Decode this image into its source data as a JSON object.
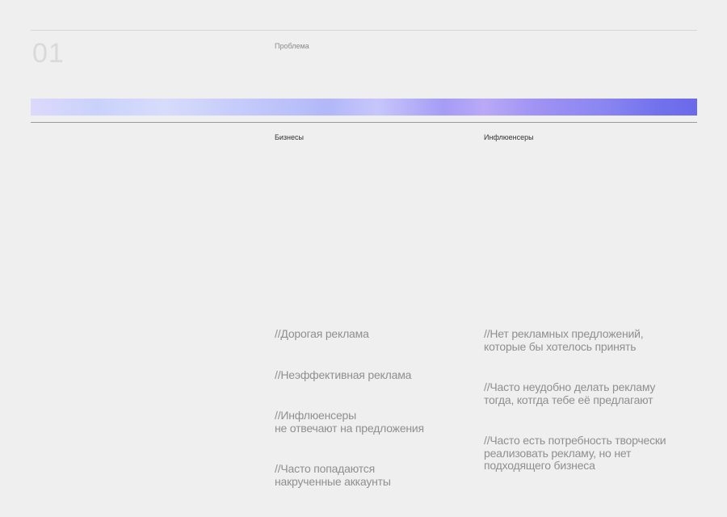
{
  "slide": {
    "number": "01",
    "section": "Проблема"
  },
  "columns": {
    "business": {
      "heading": "Бизнесы",
      "points": [
        "//Дорогая реклама",
        "//Неэффективная реклама",
        "//Инфлюенсеры\nне отвечают на предложения",
        "//Часто попадаются\nнакрученные аккаунты"
      ]
    },
    "influencers": {
      "heading": "Инфлюенсеры",
      "points": [
        "//Нет рекламных предложений,\nкоторые бы хотелось принять",
        "//Часто неудобно делать рекламу\nтогда, котгда тебе её предлагают",
        "//Часто есть потребность творчески\nреализовать рекламу, но нет\nподходящего бизнеса"
      ]
    }
  },
  "colors": {
    "background": "#efefef",
    "gradient_start": "#dcd9fb",
    "gradient_end": "#6b69ea"
  }
}
